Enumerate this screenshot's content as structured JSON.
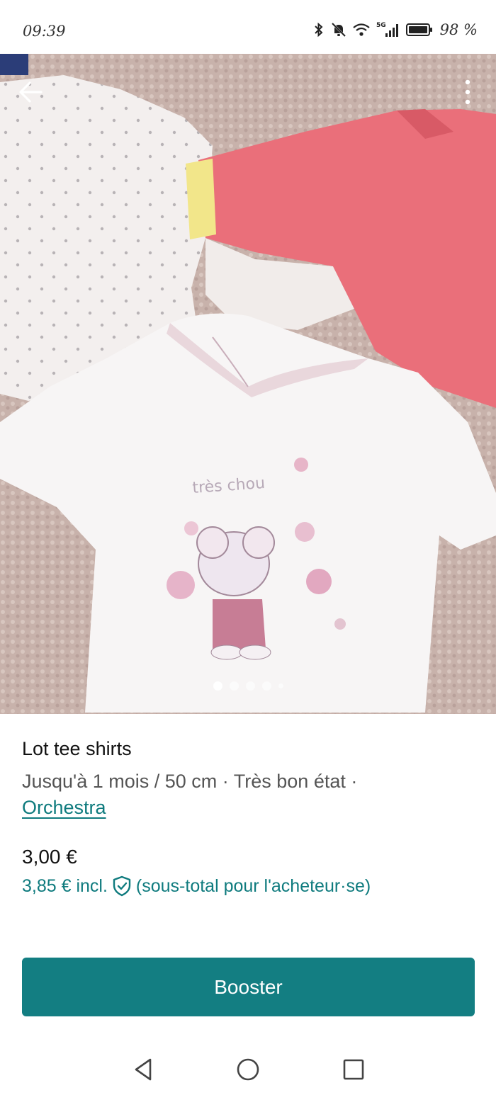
{
  "status_bar": {
    "time": "09:39",
    "battery_text": "98 %",
    "icons": [
      "bluetooth-icon",
      "mute-icon",
      "wifi-icon",
      "signal-5g-icon",
      "battery-icon"
    ]
  },
  "photo": {
    "description_icon": "product-photo",
    "carousel_count": 5,
    "carousel_active_index": 0
  },
  "product": {
    "title": "Lot tee shirts",
    "subtitle": "Jusqu'à 1 mois / 50 cm · Très bon état ·",
    "brand": "Orchestra",
    "price": "3,00 €",
    "price_incl": "3,85 € incl.",
    "price_incl_note": "(sous-total pour l'acheteur·se)"
  },
  "actions": {
    "booster_label": "Booster"
  },
  "colors": {
    "accent": "#137e82",
    "link": "#0f7b7e"
  }
}
